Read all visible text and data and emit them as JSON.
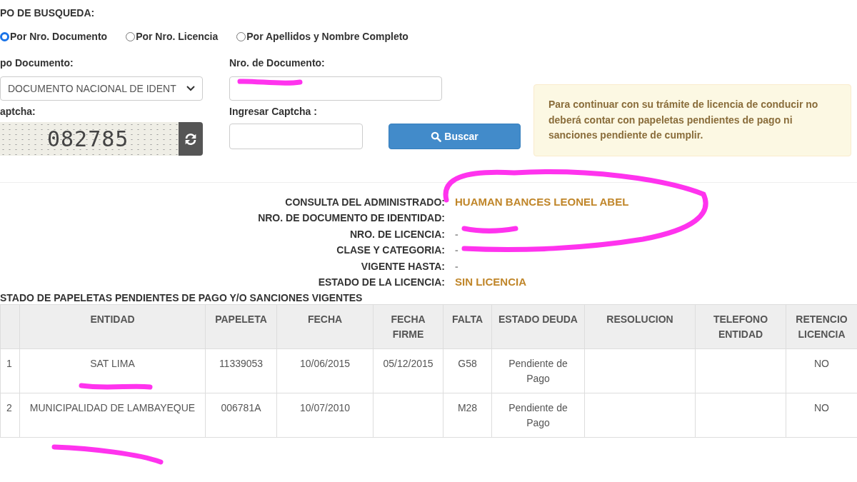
{
  "search_type": {
    "title": "PO DE BUSQUEDA:",
    "options": [
      {
        "label": "Por Nro. Documento",
        "selected": true
      },
      {
        "label": "Por Nro. Licencia",
        "selected": false
      },
      {
        "label": "Por Apellidos y Nombre Completo",
        "selected": false
      }
    ]
  },
  "document_type": {
    "label": "po Documento:",
    "value": "DOCUMENTO NACIONAL DE IDENT"
  },
  "document_number": {
    "label": "Nro. de Documento:"
  },
  "captcha": {
    "label": "aptcha:",
    "code": "082785"
  },
  "captcha_input": {
    "label": "Ingresar Captcha :"
  },
  "search_button": {
    "label": "Buscar"
  },
  "alert": {
    "text": "Para continuar con su trámite de licencia de conducir no deberá contar con papeletas pendientes de pago ni sanciones pendiente de cumplir."
  },
  "details": [
    {
      "label": "CONSULTA DEL ADMINISTRADO:",
      "value": "HUAMAN BANCES LEONEL ABEL",
      "kind": "emphasis"
    },
    {
      "label": "NRO. DE DOCUMENTO DE IDENTIDAD:",
      "kind": "redacted"
    },
    {
      "label": "NRO. DE LICENCIA:",
      "value": "-",
      "kind": "plain"
    },
    {
      "label": "CLASE Y CATEGORIA:",
      "value": "-",
      "kind": "plain"
    },
    {
      "label": "VIGENTE HASTA:",
      "value": "-",
      "kind": "plain"
    },
    {
      "label": "ESTADO DE LA LICENCIA:",
      "value": "SIN LICENCIA",
      "kind": "emphasis"
    }
  ],
  "table": {
    "title": "STADO DE PAPELETAS PENDIENTES DE PAGO Y/O SANCIONES VIGENTES",
    "columns": [
      null,
      "ENTIDAD",
      "PAPELETA",
      "FECHA",
      "FECHA FIRME",
      "FALTA",
      "ESTADO DEUDA",
      "RESOLUCION",
      "TELEFONO ENTIDAD",
      "RETENCIO LICENCIA"
    ],
    "rows": [
      [
        "1",
        "SAT LIMA",
        "11339053",
        "10/06/2015",
        "05/12/2015",
        "G58",
        "Pendiente de Pago",
        null,
        null,
        "NO"
      ],
      [
        "2",
        "MUNICIPALIDAD DE LAMBAYEQUE",
        "006781A",
        "10/07/2010",
        null,
        "M28",
        "Pendiente de Pago",
        null,
        null,
        "NO"
      ]
    ]
  }
}
